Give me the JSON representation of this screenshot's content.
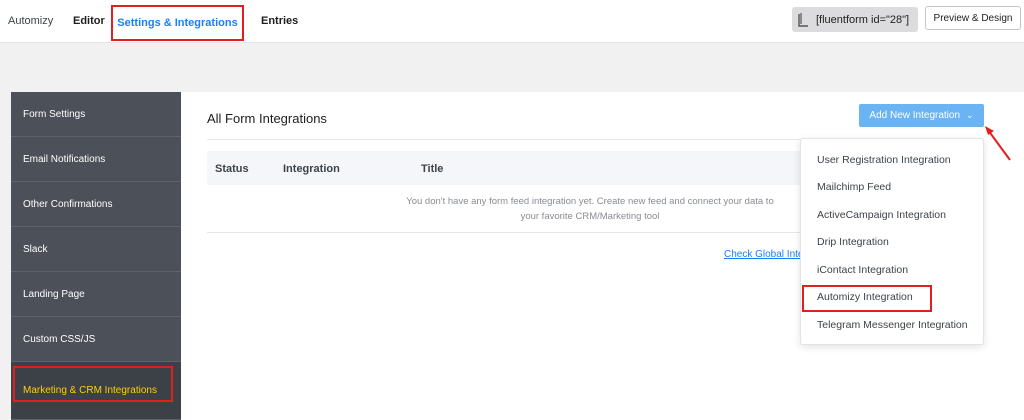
{
  "topnav": {
    "app": "Automizy",
    "editor": "Editor",
    "settings": "Settings & Integrations",
    "entries": "Entries"
  },
  "shortcode": "[fluentform id=\"28\"]",
  "preview_button": "Preview & Design",
  "sidebar": {
    "items": [
      {
        "label": "Form Settings"
      },
      {
        "label": "Email Notifications"
      },
      {
        "label": "Other Confirmations"
      },
      {
        "label": "Slack"
      },
      {
        "label": "Landing Page"
      },
      {
        "label": "Custom CSS/JS"
      },
      {
        "label": "Marketing & CRM Integrations"
      }
    ]
  },
  "panel": {
    "title": "All Form Integrations",
    "add_button": "Add New Integration",
    "table": {
      "headers": [
        "Status",
        "Integration",
        "Title"
      ]
    },
    "empty_line1": "You don't have any form feed integration yet. Create new feed and connect your data to",
    "empty_line2": "your favorite CRM/Marketing tool",
    "check_link": "Check Global Integrations"
  },
  "dropdown": {
    "items": [
      "User Registration Integration",
      "Mailchimp Feed",
      "ActiveCampaign Integration",
      "Drip Integration",
      "iContact Integration",
      "Automizy Integration",
      "Telegram Messenger Integration"
    ]
  },
  "colors": {
    "accent": "#1a7efb",
    "highlight": "#e0201e",
    "sidebar": "#4c5058",
    "active_text": "#ffd000",
    "button": "#6ab4f3"
  }
}
